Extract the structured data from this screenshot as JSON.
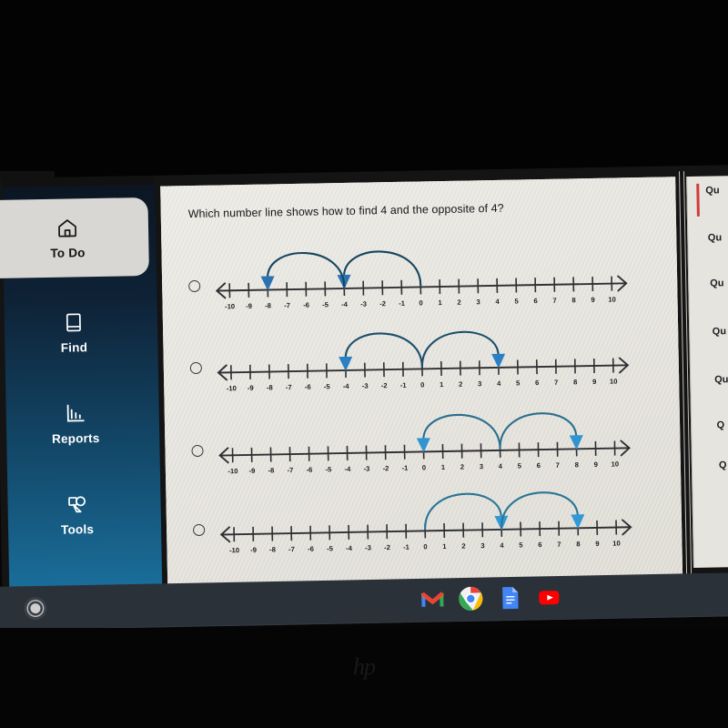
{
  "question": {
    "text": "Which number line shows how to find 4 and the opposite of 4?"
  },
  "sidebar": {
    "items": [
      {
        "label": "To Do",
        "icon": "home-icon",
        "active": true
      },
      {
        "label": "Find",
        "icon": "book-icon",
        "active": false
      },
      {
        "label": "Reports",
        "icon": "chart-icon",
        "active": false
      },
      {
        "label": "Tools",
        "icon": "tools-icon",
        "active": false
      }
    ]
  },
  "right_panel": {
    "items": [
      "Qu",
      "Qu",
      "Qu",
      "Qu",
      "Qu",
      "Q",
      "Q"
    ]
  },
  "number_lines": {
    "tick_labels": [
      "-10",
      "-9",
      "-8",
      "-7",
      "-6",
      "-5",
      "-4",
      "-3",
      "-2",
      "-1",
      "0",
      "1",
      "2",
      "3",
      "4",
      "5",
      "6",
      "7",
      "8",
      "9",
      "10"
    ],
    "min": -10,
    "max": 10,
    "options": [
      {
        "id": "option-a",
        "selected": false,
        "arc_color": "#14465f",
        "arrow_color": "#2b72b0",
        "arcs": [
          {
            "from": 0,
            "to": -4,
            "direction": "left"
          },
          {
            "from": -4,
            "to": -8,
            "direction": "left"
          }
        ]
      },
      {
        "id": "option-b",
        "selected": false,
        "arc_color": "#1b4f6b",
        "arrow_color": "#2b7fc4",
        "arcs": [
          {
            "from": 0,
            "to": -4,
            "direction": "left"
          },
          {
            "from": 0,
            "to": 4,
            "direction": "right"
          }
        ]
      },
      {
        "id": "option-c",
        "selected": false,
        "arc_color": "#2a6f8f",
        "arrow_color": "#2f94d0",
        "arcs": [
          {
            "from": 4,
            "to": 0,
            "direction": "left"
          },
          {
            "from": 4,
            "to": 8,
            "direction": "right"
          }
        ]
      },
      {
        "id": "option-d",
        "selected": false,
        "arc_color": "#2a7596",
        "arrow_color": "#3398d6",
        "arcs": [
          {
            "from": 0,
            "to": 4,
            "direction": "right"
          },
          {
            "from": 4,
            "to": 8,
            "direction": "right"
          }
        ]
      }
    ]
  },
  "shelf": {
    "launcher": "launcher-button",
    "icons": [
      {
        "name": "gmail-icon",
        "label": "Gmail"
      },
      {
        "name": "chrome-icon",
        "label": "Chrome"
      },
      {
        "name": "docs-icon",
        "label": "Docs"
      },
      {
        "name": "youtube-icon",
        "label": "YouTube"
      }
    ]
  },
  "device": {
    "brand": "hp"
  }
}
